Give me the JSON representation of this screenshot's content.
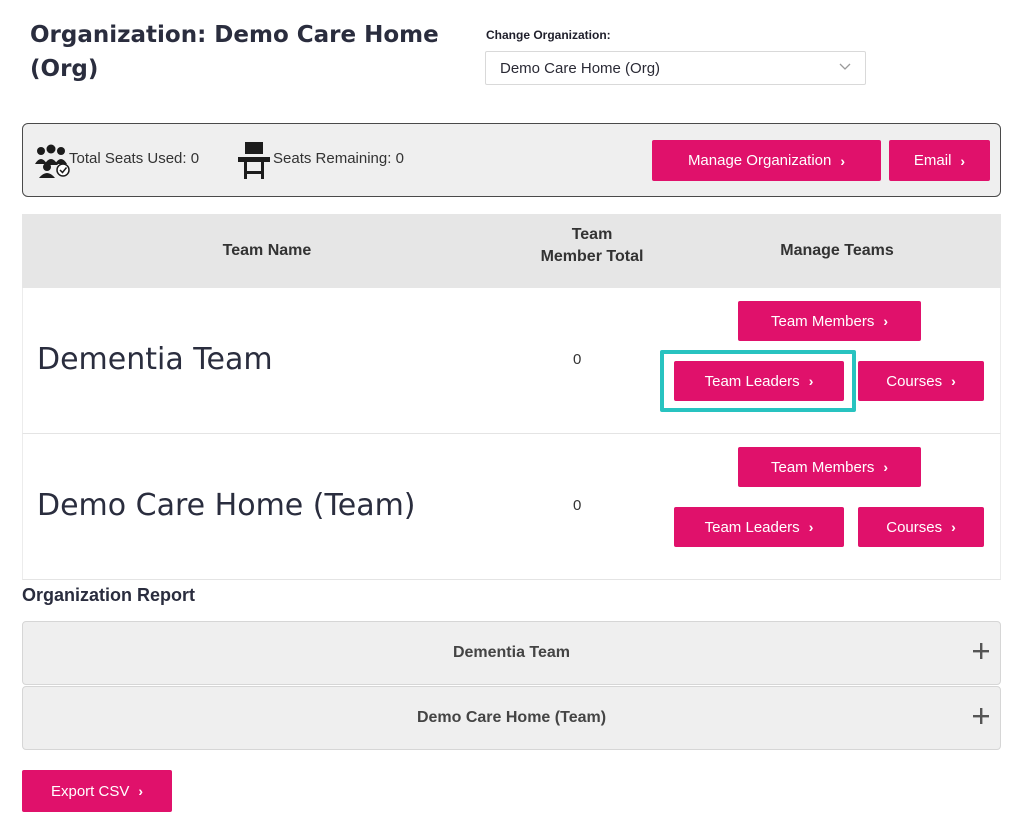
{
  "header": {
    "title": "Organization: Demo Care Home (Org)",
    "change_org_label": "Change Organization:",
    "selected_org": "Demo Care Home (Org)"
  },
  "seats": {
    "used_text": "Total Seats Used: 0",
    "remaining_text": "Seats Remaining: 0",
    "manage_org_label": "Manage Organization",
    "email_label": "Email"
  },
  "table": {
    "headers": {
      "name": "Team Name",
      "total_line1": "Team",
      "total_line2": "Member Total",
      "manage": "Manage Teams"
    },
    "rows": [
      {
        "name": "Dementia Team",
        "total": "0",
        "members_label": "Team Members",
        "leaders_label": "Team Leaders",
        "courses_label": "Courses"
      },
      {
        "name": "Demo Care Home (Team)",
        "total": "0",
        "members_label": "Team Members",
        "leaders_label": "Team Leaders",
        "courses_label": "Courses"
      }
    ]
  },
  "report": {
    "title": "Organization Report",
    "panels": [
      {
        "label": "Dementia Team"
      },
      {
        "label": "Demo Care Home (Team)"
      }
    ],
    "export_label": "Export CSV"
  },
  "icons": {
    "users": "users-group-icon",
    "seat": "chair-icon",
    "chevron": "chevron-right-icon",
    "plus": "plus-icon"
  },
  "colors": {
    "accent": "#e0116b",
    "highlight": "#28c3c0"
  }
}
